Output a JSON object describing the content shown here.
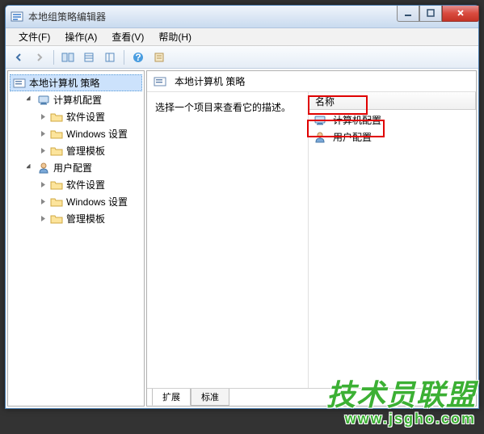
{
  "window": {
    "title": "本地组策略编辑器"
  },
  "menu": {
    "file": "文件(F)",
    "action": "操作(A)",
    "view": "查看(V)",
    "help": "帮助(H)"
  },
  "tree": {
    "root": "本地计算机 策略",
    "computer_config": "计算机配置",
    "user_config": "用户配置",
    "software_settings": "软件设置",
    "windows_settings": "Windows 设置",
    "admin_templates": "管理模板"
  },
  "right": {
    "header": "本地计算机 策略",
    "description": "选择一个项目来查看它的描述。",
    "col_name": "名称",
    "item_computer": "计算机配置",
    "item_user": "用户配置"
  },
  "tabs": {
    "extended": "扩展",
    "standard": "标准"
  },
  "watermark": {
    "main": "技术员联盟",
    "sub": "www.jsgho.com"
  }
}
